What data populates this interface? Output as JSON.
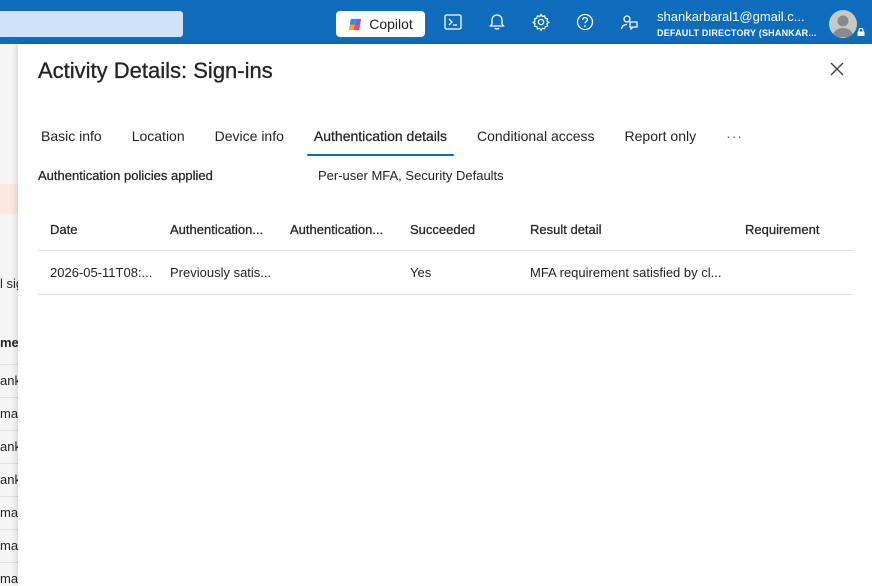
{
  "topbar": {
    "copilot_label": "Copilot",
    "account_email": "shankarbaral1@gmail.c...",
    "account_directory": "DEFAULT DIRECTORY (SHANKAR...",
    "accent_color": "#0f6cbd",
    "icons": [
      "cloud-shell-icon",
      "bell-icon",
      "gear-icon",
      "help-icon",
      "feedback-icon"
    ]
  },
  "background": {
    "texts": [
      "l sig",
      "me",
      "ank",
      "mai",
      "ank",
      "ank",
      "mai",
      "mai",
      "mai"
    ]
  },
  "panel": {
    "title": "Activity Details: Sign-ins",
    "tabs": [
      {
        "label": "Basic info"
      },
      {
        "label": "Location"
      },
      {
        "label": "Device info"
      },
      {
        "label": "Authentication details",
        "active": true
      },
      {
        "label": "Conditional access"
      },
      {
        "label": "Report only"
      }
    ],
    "more_label": "···",
    "policies_label": "Authentication policies applied",
    "policies_value": "Per-user MFA, Security Defaults"
  },
  "table": {
    "headers": [
      "Date",
      "Authentication...",
      "Authentication...",
      "Succeeded",
      "Result detail",
      "Requirement"
    ],
    "rows": [
      {
        "date": "2026-05-11T08:...",
        "auth_method": "Previously satis...",
        "auth_detail": "",
        "succeeded": "Yes",
        "result_detail": "MFA requirement satisfied by cl...",
        "requirement": ""
      }
    ]
  }
}
